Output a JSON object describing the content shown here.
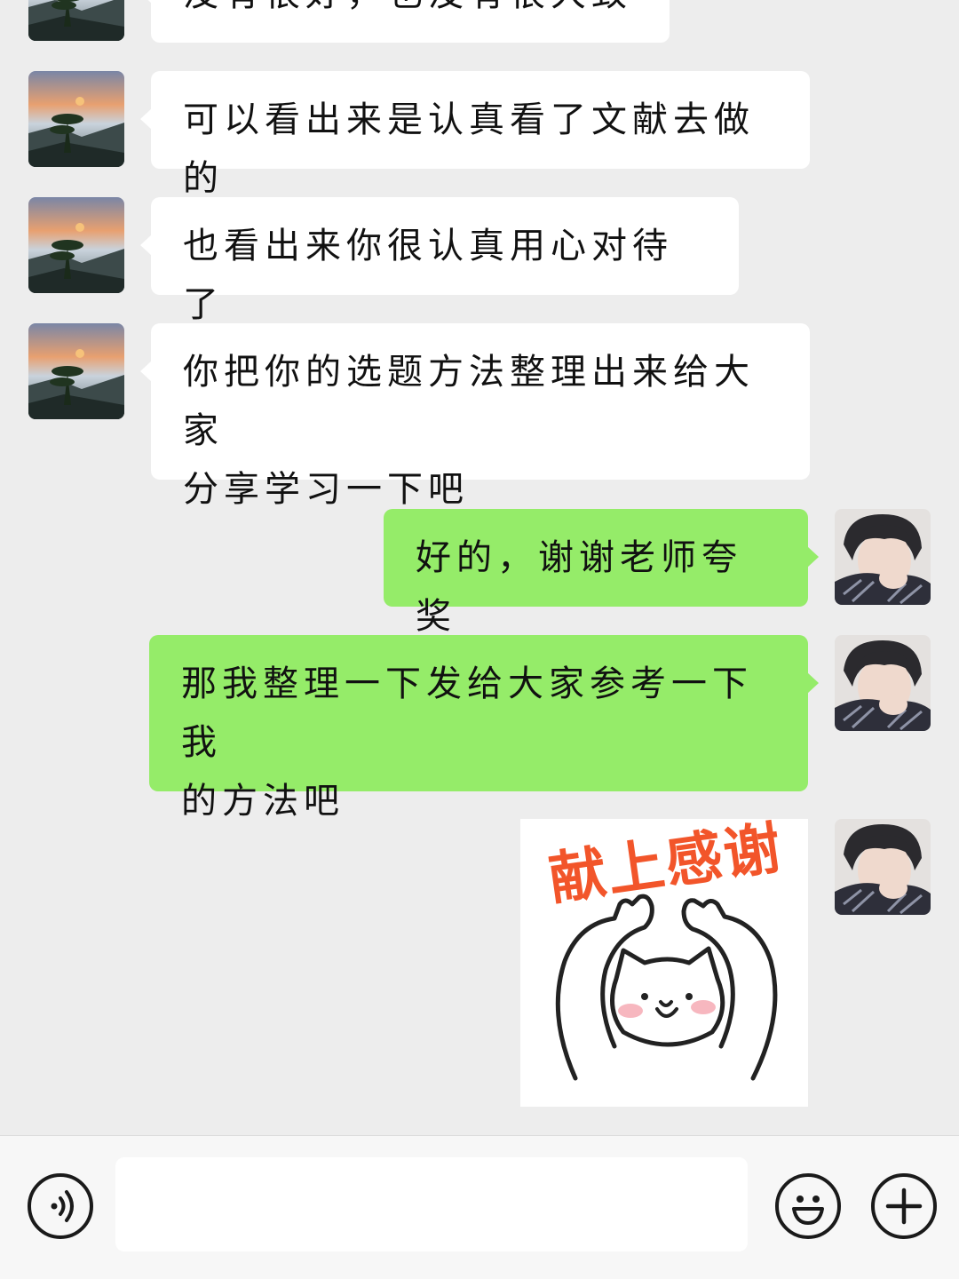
{
  "messages": [
    {
      "side": "in",
      "text": "没有很好，也没有很大致"
    },
    {
      "side": "in",
      "text": "可以看出来是认真看了文献去做的"
    },
    {
      "side": "in",
      "text": "也看出来你很认真用心对待了"
    },
    {
      "side": "in",
      "line1": "你把你的选题方法整理出来给大家",
      "line2": "分享学习一下吧"
    },
    {
      "side": "out",
      "text": "好的，谢谢老师夸奖"
    },
    {
      "side": "out",
      "line1": "那我整理一下发给大家参考一下我",
      "line2": "的方法吧"
    },
    {
      "side": "out",
      "sticker_text": "献上感谢",
      "sticker_subject": "white-cat-raising-paws"
    }
  ],
  "input_bar": {
    "voice_icon": "voice-icon",
    "message_value": "",
    "emoji_icon": "emoji-icon",
    "plus_icon": "plus-icon"
  },
  "colors": {
    "chat_background": "#ededed",
    "incoming_bubble": "#ffffff",
    "outgoing_bubble": "#95ec69",
    "sticker_text": "#f2552a",
    "input_bar": "#f7f7f7"
  }
}
